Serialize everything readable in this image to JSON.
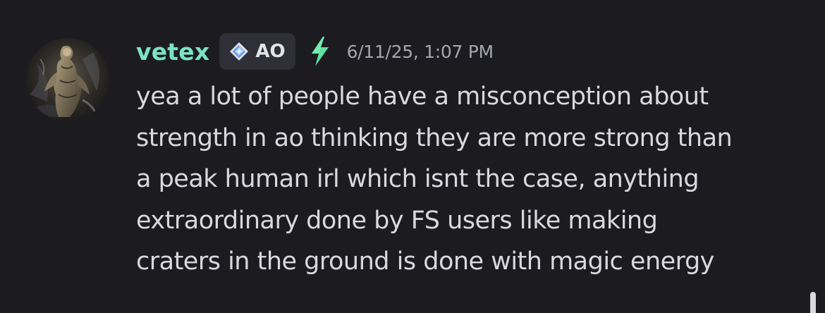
{
  "message": {
    "author": {
      "username": "vetex",
      "avatar_icon": "statue-avatar",
      "username_color": "#7be3c4"
    },
    "server_tag": {
      "icon": "diamond-sparkle-icon",
      "label": "AO"
    },
    "badge_icon": "lightning-bolt-icon",
    "timestamp": "6/11/25, 1:07 PM",
    "content_lines": [
      "yea a lot of people have a misconception about",
      "strength in ao thinking they are more strong than",
      "a peak human irl which isnt the case, anything",
      "extraordinary done by FS users like making",
      "craters in the ground is done with magic energy"
    ]
  },
  "colors": {
    "background": "#1c1c20",
    "text": "#d8d9de",
    "timestamp": "#a4a6ae",
    "tag_bg": "#2e2f37",
    "bolt": "#5ee0a0"
  }
}
